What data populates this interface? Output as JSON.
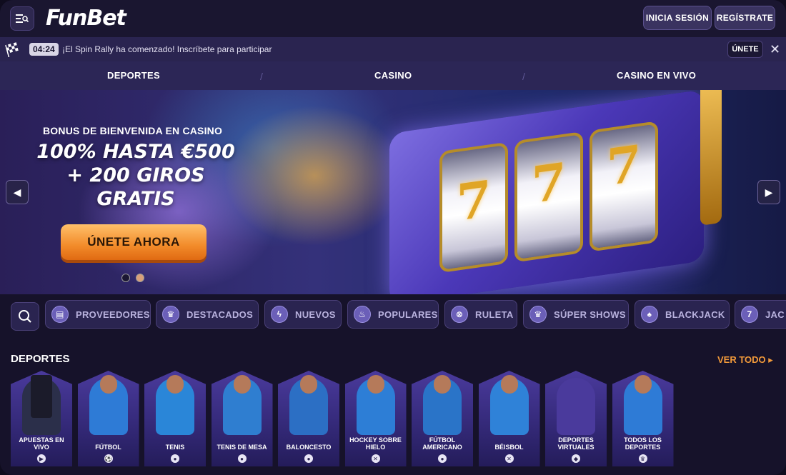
{
  "header": {
    "logo": "FunBet",
    "login_label": "INICIA SESIÓN",
    "register_label": "REGÍSTRATE"
  },
  "promo": {
    "timer": "04:24",
    "text": "¡El Spin Rally ha comenzado! Inscríbete para participar",
    "join_label": "ÚNETE",
    "close_glyph": "✕"
  },
  "nav": {
    "tabs": [
      {
        "label": "DEPORTES"
      },
      {
        "label": "CASINO"
      },
      {
        "label": "CASINO EN VIVO"
      }
    ]
  },
  "banner": {
    "subtitle": "BONUS DE BIENVENIDA EN CASINO",
    "title_line1": "100% HASTA €500",
    "title_line2": "+ 200 GIROS",
    "title_line3": "GRATIS",
    "cta_label": "ÚNETE AHORA",
    "slide_count": 2,
    "active_slide": 1,
    "reel_symbol": "7"
  },
  "categories": [
    {
      "label": "PROVEEDORES",
      "icon": "book-icon",
      "glyph": "▤"
    },
    {
      "label": "DESTACADOS",
      "icon": "crown-icon",
      "glyph": "♛"
    },
    {
      "label": "NUEVOS",
      "icon": "lightning-icon",
      "glyph": "ϟ"
    },
    {
      "label": "POPULARES",
      "icon": "flame-icon",
      "glyph": "♨"
    },
    {
      "label": "RULETA",
      "icon": "roulette-icon",
      "glyph": "⊗"
    },
    {
      "label": "SÚPER SHOWS",
      "icon": "crown-show-icon",
      "glyph": "♛"
    },
    {
      "label": "BLACKJACK",
      "icon": "spade-icon",
      "glyph": "♠"
    },
    {
      "label": "JAC",
      "icon": "seven-icon",
      "glyph": "7"
    }
  ],
  "sports": {
    "title": "DEPORTES",
    "see_all": "VER TODO ▸",
    "items": [
      {
        "label": "APUESTAS EN VIVO",
        "icon": "play-icon",
        "glyph": "▶",
        "color": "#2b2f4a"
      },
      {
        "label": "FÚTBOL",
        "icon": "football-icon",
        "glyph": "⚽",
        "color": "#2e7bd6"
      },
      {
        "label": "TENIS",
        "icon": "tennis-icon",
        "glyph": "●",
        "color": "#2a86d8"
      },
      {
        "label": "TENIS DE MESA",
        "icon": "ping-pong-icon",
        "glyph": "●",
        "color": "#2f7ed0"
      },
      {
        "label": "BALONCESTO",
        "icon": "basketball-icon",
        "glyph": "●",
        "color": "#2c6fc4"
      },
      {
        "label": "HOCKEY SOBRE HIELO",
        "icon": "hockey-icon",
        "glyph": "✕",
        "color": "#2d7ed6"
      },
      {
        "label": "FÚTBOL AMERICANO",
        "icon": "american-football-icon",
        "glyph": "●",
        "color": "#2a74c8"
      },
      {
        "label": "BÉISBOL",
        "icon": "baseball-icon",
        "glyph": "✕",
        "color": "#2f82d8"
      },
      {
        "label": "DEPORTES VIRTUALES",
        "icon": "gamepad-icon",
        "glyph": "◆",
        "color": "#4a3a9c"
      },
      {
        "label": "TODOS LOS DEPORTES",
        "icon": "trophy-icon",
        "glyph": "♛",
        "color": "#2e7bd6"
      }
    ]
  }
}
